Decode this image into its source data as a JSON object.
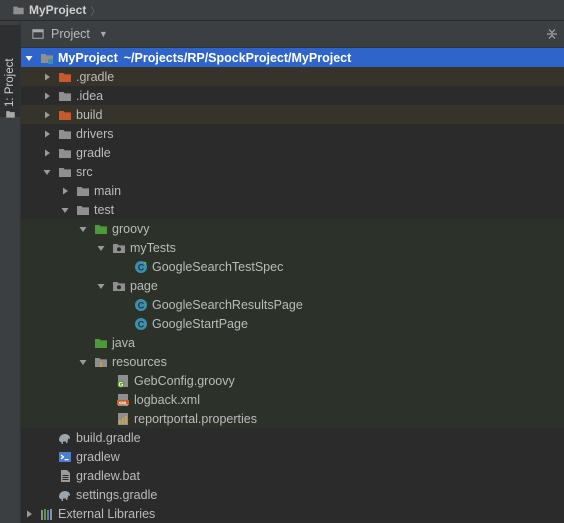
{
  "breadcrumb": {
    "root": "MyProject"
  },
  "tool_strip": {
    "project_tab_label": "1: Project"
  },
  "panel": {
    "title": "Project"
  },
  "tree": {
    "root_label": "MyProject",
    "root_path": "~/Projects/RP/SpockProject/MyProject",
    "items": {
      "gradle_hidden": ".gradle",
      "idea": ".idea",
      "build": "build",
      "drivers": "drivers",
      "gradle": "gradle",
      "src": "src",
      "main": "main",
      "test": "test",
      "groovy": "groovy",
      "my_tests": "myTests",
      "google_search_test_spec": "GoogleSearchTestSpec",
      "page": "page",
      "google_search_results_page": "GoogleSearchResultsPage",
      "google_start_page": "GoogleStartPage",
      "java": "java",
      "resources": "resources",
      "geb_config": "GebConfig.groovy",
      "logback": "logback.xml",
      "reportportal": "reportportal.properties",
      "build_gradle": "build.gradle",
      "gradlew": "gradlew",
      "gradlew_bat": "gradlew.bat",
      "settings_gradle": "settings.gradle",
      "external_libraries": "External Libraries"
    }
  },
  "colors": {
    "selection": "#2f65ca",
    "excluded_folder": "#c65a2d",
    "source_folder": "#5e9b33",
    "test_folder": "#4e9a3a",
    "plain_folder": "#8f8f8f",
    "class_icon": "#3d8fb0"
  }
}
